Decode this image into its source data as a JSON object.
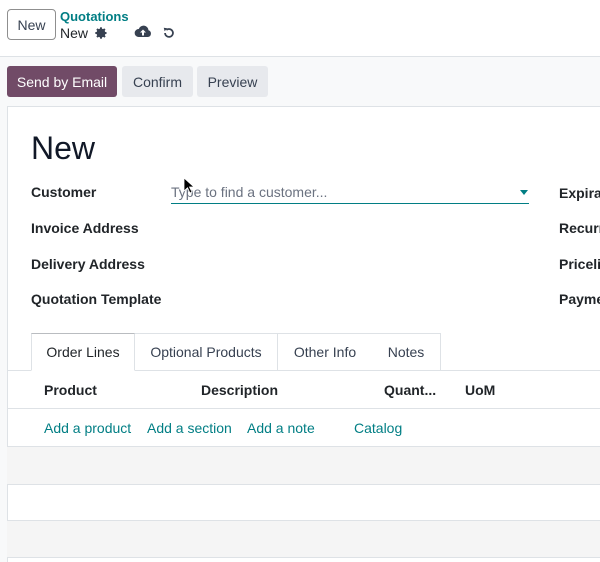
{
  "control_panel": {
    "new_button": "New",
    "breadcrumb_parent": "Quotations",
    "breadcrumb_current": "New",
    "icons": [
      "gear-icon",
      "cloud-upload-icon",
      "undo-icon"
    ]
  },
  "status_buttons": {
    "send_email": "Send by Email",
    "confirm": "Confirm",
    "preview": "Preview"
  },
  "form": {
    "title": "New",
    "labels": {
      "customer": "Customer",
      "invoice_address": "Invoice Address",
      "delivery_address": "Delivery Address",
      "quotation_template": "Quotation Template"
    },
    "right_labels": {
      "expiration": "Expira",
      "recurrence": "Recurr",
      "pricelist": "Priceli",
      "payment": "Payme"
    },
    "customer_placeholder": "Type to find a customer..."
  },
  "tabs": [
    "Order Lines",
    "Optional Products",
    "Other Info",
    "Notes"
  ],
  "table": {
    "headers": [
      "Product",
      "Description",
      "Quant...",
      "UoM"
    ],
    "actions": [
      "Add a product",
      "Add a section",
      "Add a note",
      "Catalog"
    ]
  },
  "colors": {
    "primary": "#714b67",
    "link": "#017e84"
  }
}
